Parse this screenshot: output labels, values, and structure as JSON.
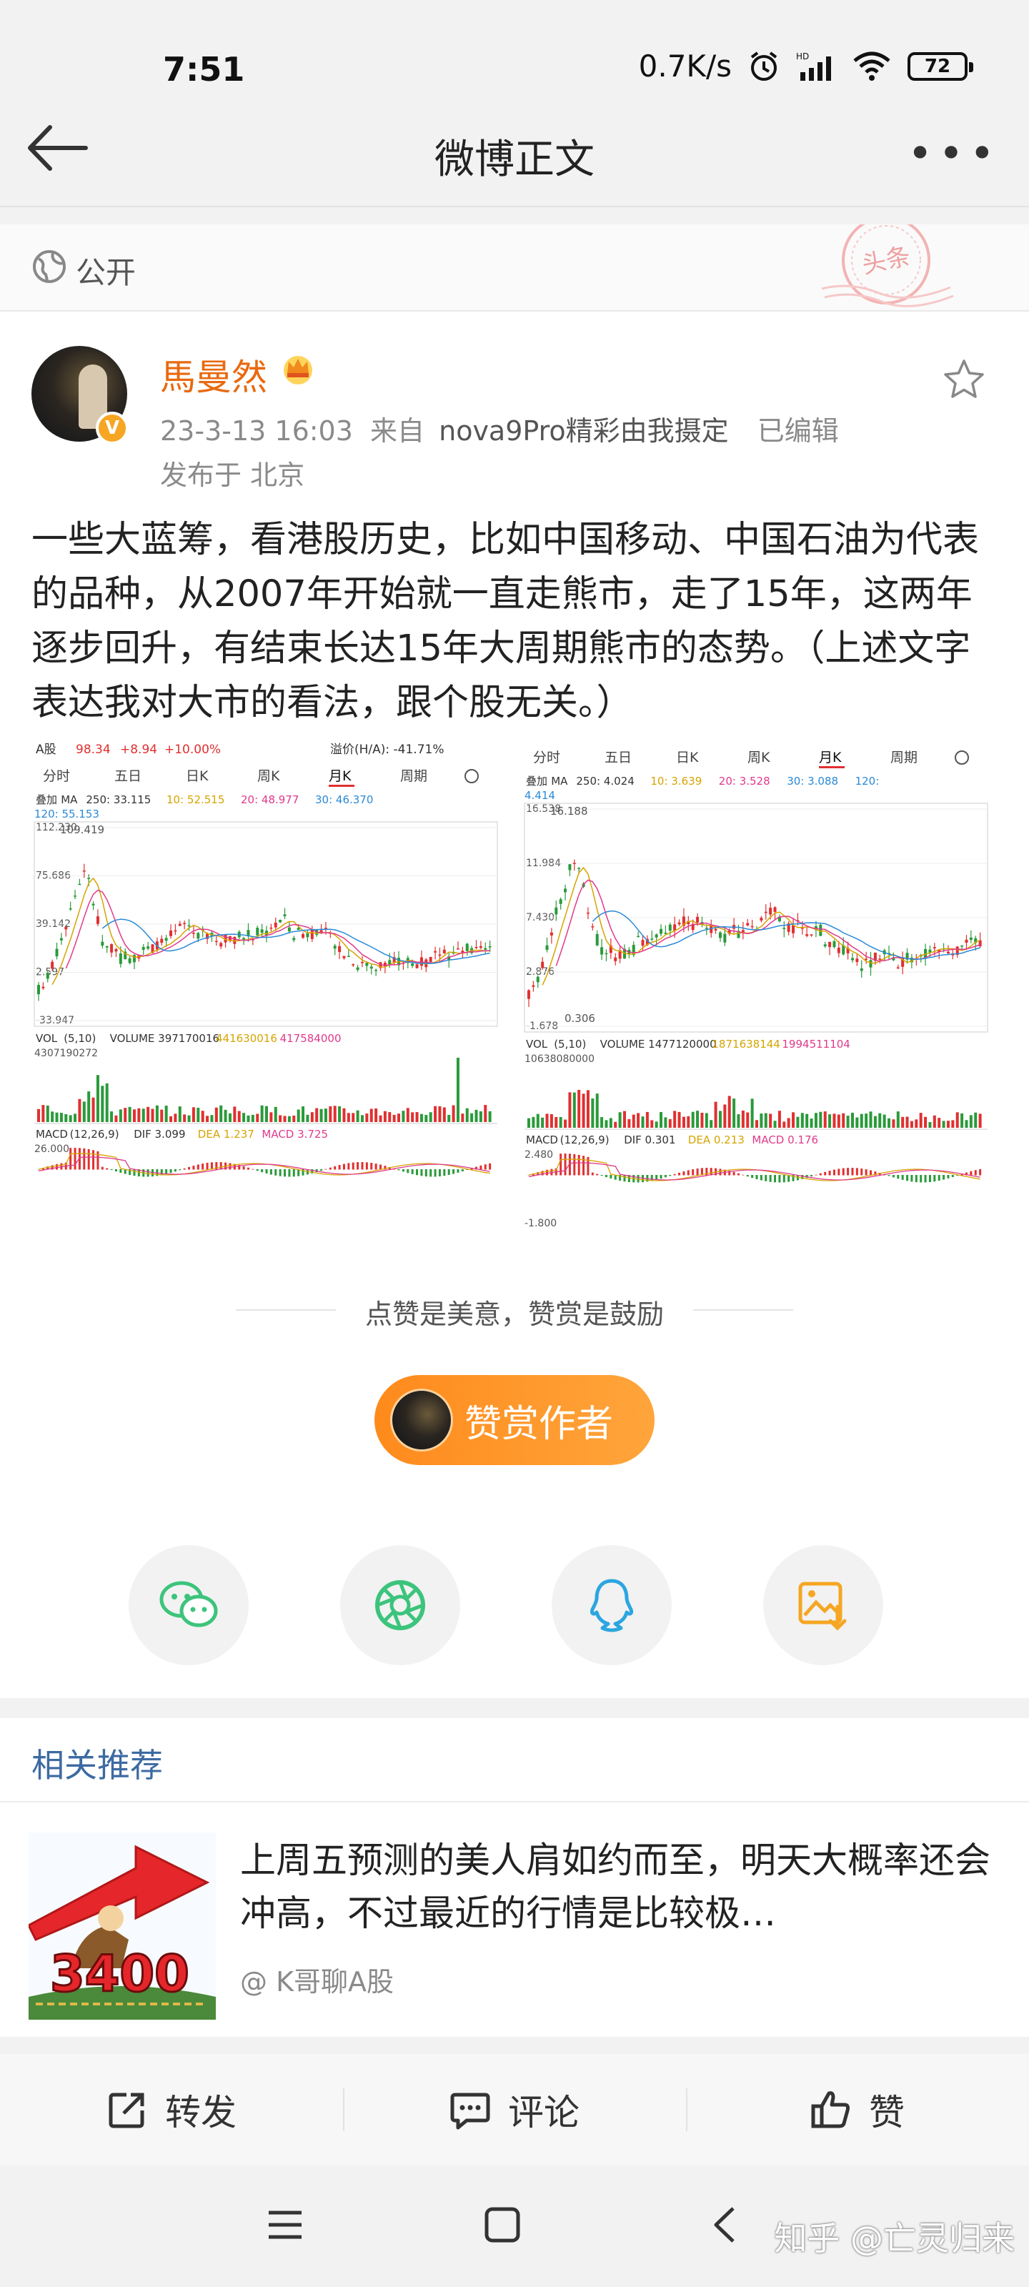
{
  "status_bar": {
    "time": "7:51",
    "speed": "0.7K/s",
    "battery": "72"
  },
  "nav": {
    "title": "微博正文"
  },
  "visibility": {
    "label": "公开",
    "stamp_text": "头条"
  },
  "author": {
    "name": "馬曼然",
    "date": "23-3-13 16:03",
    "from_prefix": "来自",
    "source": "nova9Pro精彩由我摄定",
    "edited": "已编辑",
    "location": "发布于 北京"
  },
  "post": {
    "text": "一些大蓝筹，看港股历史，比如中国移动、中国石油为代表的品种，从2007年开始就一直走熊市，走了15年，这两年逐步回升，有结束长达15年大周期熊市的态势。（上述文字表达我对大市的看法，跟个股无关。）"
  },
  "charts": [
    {
      "header": "A股",
      "price": "98.34",
      "change": "+8.94",
      "pct": "+10.00%",
      "premium": "溢价(H/A): -41.71%",
      "tabs": [
        "分时",
        "五日",
        "日K",
        "周K",
        "月K",
        "周期"
      ],
      "active_tab": 4,
      "ma_line": [
        "叠加",
        "MA",
        "250: 33.115",
        "10: 52.515",
        "20: 48.977",
        "30: 46.370"
      ],
      "ma120": "120: 55.153",
      "ticks": [
        "112.230",
        "75.686",
        "39.142",
        "2.597",
        "-33.947"
      ],
      "peak": "109.419",
      "vol_line": [
        "VOL",
        "(5,10)",
        "VOLUME 397170016",
        "441630016",
        "417584000"
      ],
      "vol_max": "4307190272",
      "macd_line": [
        "MACD",
        "(12,26,9)",
        "DIF 3.099",
        "DEA 1.237",
        "MACD 3.725"
      ],
      "macd_max": "26.000"
    },
    {
      "tabs": [
        "分时",
        "五日",
        "日K",
        "周K",
        "月K",
        "周期"
      ],
      "active_tab": 4,
      "ma_line": [
        "叠加",
        "MA",
        "250: 4.024",
        "10: 3.639",
        "20: 3.528",
        "30: 3.088",
        "120:"
      ],
      "ma120": "4.414",
      "ticks": [
        "16.538",
        "11.984",
        "7.430",
        "2.876",
        "-1.678"
      ],
      "peak": "16.188",
      "low": "0.306",
      "vol_line": [
        "VOL",
        "(5,10)",
        "VOLUME 1477120000",
        "1871638144",
        "1994511104"
      ],
      "vol_max": "10638080000",
      "macd_line": [
        "MACD",
        "(12,26,9)",
        "DIF 0.301",
        "DEA 0.213",
        "MACD 0.176"
      ],
      "macd_max": "2.480",
      "macd_min": "-1.800"
    }
  ],
  "reward": {
    "hint": "点赞是美意，赞赏是鼓励",
    "button": "赞赏作者"
  },
  "share": [
    {
      "icon": "wechat-icon",
      "color": "#3cc47c"
    },
    {
      "icon": "moments-icon",
      "color": "#3cc47c"
    },
    {
      "icon": "qq-icon",
      "color": "#2ca6e0"
    },
    {
      "icon": "save-image-icon",
      "color": "#f5a623"
    }
  ],
  "related": {
    "title": "相关推荐",
    "item": {
      "text": "上周五预测的美人肩如约而至，明天大概率还会冲高，不过最近的行情是比较极…",
      "source": "@ K哥聊A股",
      "image_text": "3400"
    }
  },
  "actions": {
    "repost": "转发",
    "comment": "评论",
    "like": "赞"
  },
  "watermark": "知乎 @亡灵归来"
}
